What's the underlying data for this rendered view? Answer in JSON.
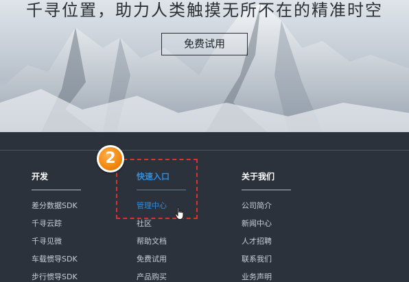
{
  "hero": {
    "slogan": "千寻位置，助力人类触摸无所不在的精准时空",
    "trial_button": "免费试用"
  },
  "footer": {
    "columns": [
      {
        "title": "开发",
        "links": [
          "差分数据SDK",
          "千寻云踪",
          "千寻见微",
          "车载惯导SDK",
          "步行惯导SDK"
        ]
      },
      {
        "title": "快速入口",
        "links": [
          "管理中心",
          "社区",
          "帮助文档",
          "免费试用",
          "产品购买"
        ]
      },
      {
        "title": "关于我们",
        "links": [
          "公司简介",
          "新闻中心",
          "人才招聘",
          "联系我们",
          "业务声明"
        ]
      }
    ]
  },
  "annotation": {
    "step_number": "2",
    "highlight_color": "#e0322c",
    "badge_color": "#f38a12"
  },
  "colors": {
    "footer_bg": "#2b323c",
    "accent": "#2f8ee0"
  },
  "icons": {
    "cursor": "hand-pointer-icon"
  }
}
